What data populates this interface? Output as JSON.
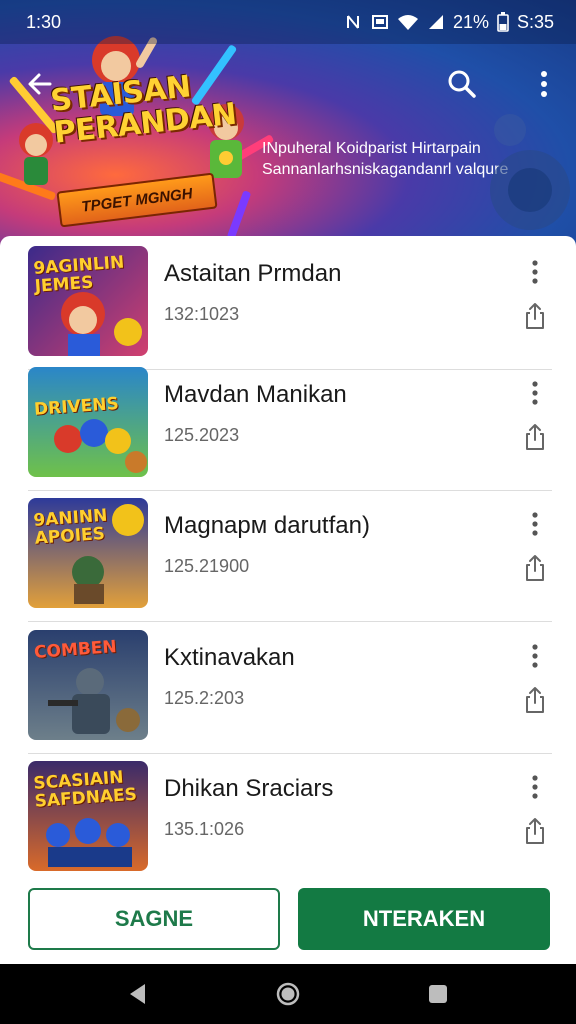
{
  "status_bar": {
    "time": "1:30",
    "battery_text": "21%",
    "clock_right": "S:35",
    "icons": [
      "nfc-icon",
      "cast-icon",
      "wifi-icon",
      "signal-icon",
      "battery-icon"
    ]
  },
  "header": {
    "banner_title": "STAISAN PERANDAN",
    "banner_ribbon": "TPGET MGNGH",
    "tagline_line1": "INpuheral Koidparist Hirtarpain",
    "tagline_line2": "Sannanlarhsniskagandanrl valqure",
    "icons": {
      "back": "arrow-left-icon",
      "search": "search-icon",
      "more": "more-vertical-icon"
    }
  },
  "items": [
    {
      "title": "Astaitan Prmdan",
      "meta": "132:1023",
      "thumb_text": "9AGINLIN JEMES",
      "thumb_colors": [
        "#3b2a8a",
        "#d1406f"
      ]
    },
    {
      "title": "Mavdan Manikan",
      "meta": "125.2023",
      "thumb_text": "DRIVENS",
      "thumb_colors": [
        "#2a86c9",
        "#6fc14a"
      ]
    },
    {
      "title": "Magnapм darutfan)",
      "meta": "125.21900",
      "thumb_text": "9ANINN APOIES",
      "thumb_colors": [
        "#2d3a9a",
        "#e2a03a"
      ]
    },
    {
      "title": "Kxtinavakan",
      "meta": "125.2:203",
      "thumb_text": "COMBEN",
      "thumb_colors": [
        "#2a3f6e",
        "#6d7f8a"
      ]
    },
    {
      "title": "Dhikan Sraciars",
      "meta": "135.1:026",
      "thumb_text": "SCASIAIN SAFDNAES",
      "thumb_colors": [
        "#3a2a6a",
        "#d96a2a"
      ]
    }
  ],
  "actions": {
    "secondary_label": "SAGNE",
    "primary_label": "NTERAKEN",
    "accent": "#137a43"
  },
  "nav": {
    "icons": [
      "back-triangle-icon",
      "home-circle-icon",
      "recents-square-icon"
    ]
  }
}
